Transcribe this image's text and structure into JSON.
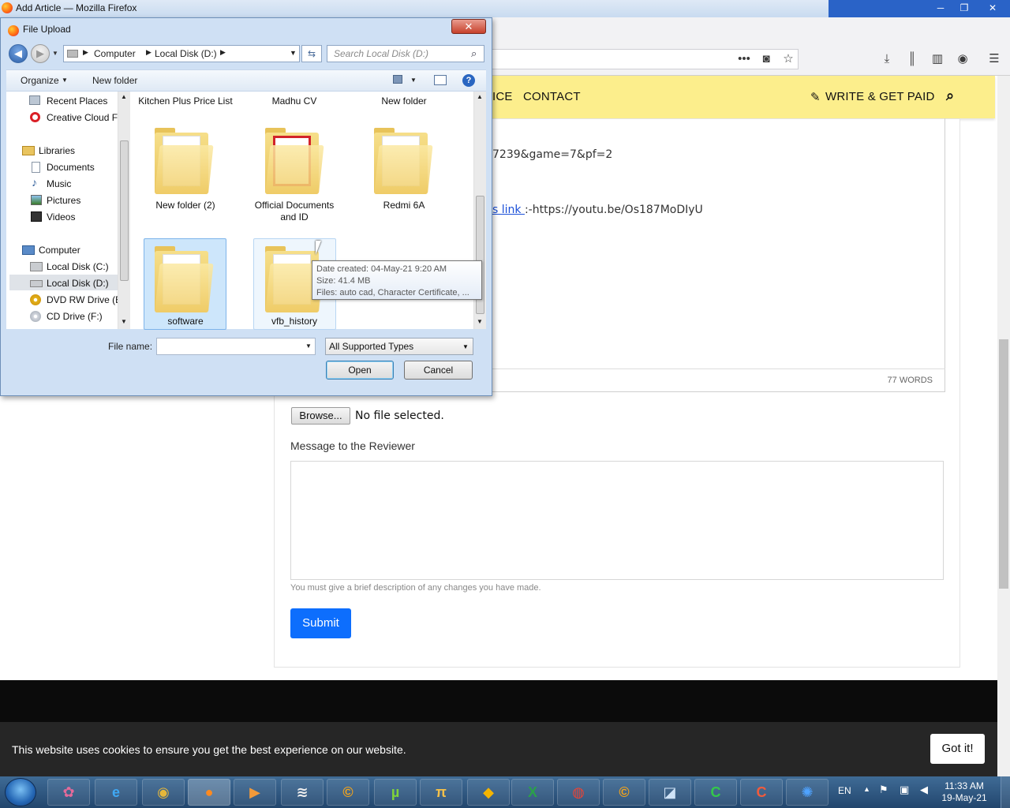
{
  "window": {
    "title": "Add Article — Mozilla Firefox"
  },
  "site": {
    "nav": {
      "item_partial": "ICE",
      "contact": "CONTACT",
      "write": "WRITE & GET PAID"
    },
    "editor": {
      "line1": "7239&game=7&pf=2",
      "line2_link": "s link ",
      "line2_rest": ":-https://youtu.be/Os187MoDIyU",
      "word_count": "77 WORDS"
    },
    "upload": {
      "browse": "Browse...",
      "status": "No file selected."
    },
    "reviewer": {
      "label": "Message to the Reviewer",
      "help": "You must give a brief description of any changes you have made."
    },
    "submit": "Submit",
    "cookie": {
      "text": "This website uses cookies to ensure you get the best experience on our website.",
      "button": "Got it!"
    }
  },
  "dialog": {
    "title": "File Upload",
    "address": {
      "computer": "Computer",
      "disk": "Local Disk (D:)"
    },
    "search_placeholder": "Search Local Disk (D:)",
    "toolbar": {
      "organize": "Organize",
      "new_folder": "New folder"
    },
    "nav": {
      "recent": "Recent Places",
      "creative": "Creative Cloud Fi",
      "libraries": "Libraries",
      "documents": "Documents",
      "music": "Music",
      "pictures": "Pictures",
      "videos": "Videos",
      "computer": "Computer",
      "disk_c": "Local Disk (C:)",
      "disk_d": "Local Disk (D:)",
      "dvd": "DVD RW Drive (E:",
      "cd": "CD Drive (F:)"
    },
    "files": {
      "kitchen": "Kitchen Plus Price List",
      "madhu": "Madhu CV",
      "newfolder": "New folder",
      "newfolder2": "New folder (2)",
      "official": "Official Documents and ID",
      "redmi": "Redmi 6A",
      "software": "software",
      "vfb": "vfb_history"
    },
    "tooltip": {
      "created": "Date created: 04-May-21 9:20 AM",
      "size": "Size: 41.4 MB",
      "files": "Files: auto cad, Character Certificate, ..."
    },
    "filename_label": "File name:",
    "filename_value": "",
    "filetype": "All Supported Types",
    "open": "Open",
    "cancel": "Cancel"
  },
  "taskbar": {
    "lang": "EN",
    "time": "11:33 AM",
    "date": "19-May-21"
  },
  "colors": {
    "nav_yellow": "#fcee8c",
    "submit_blue": "#0d6efd",
    "taskbar": "#2c5580"
  }
}
